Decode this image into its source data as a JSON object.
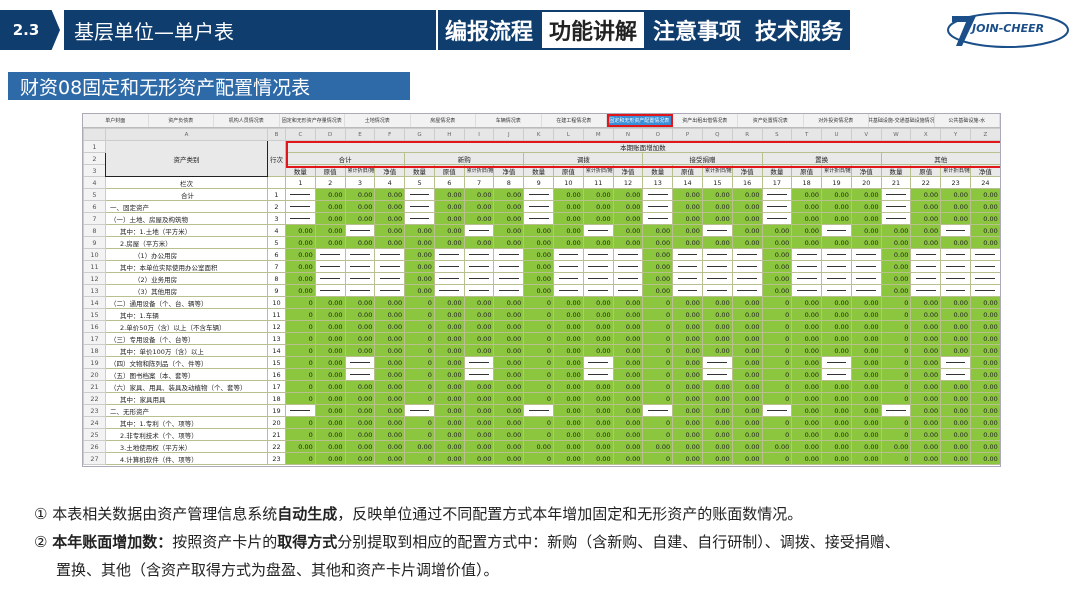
{
  "header": {
    "section_number": "2.3",
    "section_title": "基层单位—单户表",
    "tabs": [
      {
        "label": "编报流程",
        "active": false
      },
      {
        "label": "功能讲解",
        "active": true
      },
      {
        "label": "注意事项",
        "active": false
      },
      {
        "label": "技术服务",
        "active": false
      }
    ],
    "logo_text": "JOIN-CHEER",
    "colors": {
      "primary": "#0f3d6e",
      "accent": "#2e6aa8",
      "cell_green": "#8cc63f",
      "highlight": "#e0161b"
    }
  },
  "subtitle": "财资08固定和无形资产配置情况表",
  "sheet_tabs": [
    {
      "label": "单户封面",
      "active": false
    },
    {
      "label": "资产负债表",
      "active": false
    },
    {
      "label": "机构人员情况表",
      "active": false
    },
    {
      "label": "固定和无形资产存量情况表",
      "active": false
    },
    {
      "label": "土地情况表",
      "active": false
    },
    {
      "label": "房屋情况表",
      "active": false
    },
    {
      "label": "车辆情况表",
      "active": false
    },
    {
      "label": "在建工程情况表",
      "active": false
    },
    {
      "label": "固定和无形资产配置情况表",
      "active": true
    },
    {
      "label": "资产出租出借情况表",
      "active": false
    },
    {
      "label": "资产处置情况表",
      "active": false
    },
    {
      "label": "对外投资情况表",
      "active": false
    },
    {
      "label": "公共基础设施-交通基础设施情况表",
      "active": false
    },
    {
      "label": "公共基础设施-水",
      "active": false
    }
  ],
  "table": {
    "col_letters": [
      "",
      "A",
      "B",
      "C",
      "D",
      "E",
      "F",
      "G",
      "H",
      "I",
      "J",
      "K",
      "L",
      "M",
      "N",
      "O",
      "P",
      "Q",
      "R",
      "S",
      "T",
      "U",
      "V",
      "W",
      "X",
      "Y",
      "Z"
    ],
    "title": "本期账面增加数",
    "category_header": "资产类别",
    "row_header": "行次",
    "groups": [
      "合计",
      "新购",
      "调拨",
      "接受捐赠",
      "置换",
      "其他"
    ],
    "subcols": [
      "数量",
      "原值",
      "累计折旧/摊销",
      "净值"
    ],
    "col_label": "栏次",
    "col_numbers": [
      "1",
      "2",
      "3",
      "4",
      "5",
      "6",
      "7",
      "8",
      "9",
      "10",
      "11",
      "12",
      "13",
      "14",
      "15",
      "16",
      "17",
      "18",
      "19",
      "20",
      "21",
      "22",
      "23",
      "24"
    ],
    "rows": [
      {
        "cat": "合计",
        "order": "1",
        "cols": [
          "d",
          "0.00",
          "0.00",
          "0.00",
          "d",
          "0.00",
          "0.00",
          "0.00",
          "d",
          "0.00",
          "0.00",
          "0.00",
          "d",
          "0.00",
          "0.00",
          "0.00",
          "d",
          "0.00",
          "0.00",
          "0.00",
          "d",
          "0.00",
          "0.00",
          "0.00"
        ]
      },
      {
        "cat": "一、固定资产",
        "order": "2",
        "cols": [
          "d",
          "0.00",
          "0.00",
          "0.00",
          "d",
          "0.00",
          "0.00",
          "0.00",
          "d",
          "0.00",
          "0.00",
          "0.00",
          "d",
          "0.00",
          "0.00",
          "0.00",
          "d",
          "0.00",
          "0.00",
          "0.00",
          "d",
          "0.00",
          "0.00",
          "0.00"
        ]
      },
      {
        "cat": "（一）土地、房屋及构筑物",
        "order": "3",
        "cols": [
          "d",
          "0.00",
          "0.00",
          "0.00",
          "d",
          "0.00",
          "0.00",
          "0.00",
          "d",
          "0.00",
          "0.00",
          "0.00",
          "d",
          "0.00",
          "0.00",
          "0.00",
          "d",
          "0.00",
          "0.00",
          "0.00",
          "d",
          "0.00",
          "0.00",
          "0.00"
        ]
      },
      {
        "cat": "其中：1.土地（平方米）",
        "order": "4",
        "cols": [
          "0.00",
          "0.00",
          "d",
          "0.00",
          "0.00",
          "0.00",
          "d",
          "0.00",
          "0.00",
          "0.00",
          "d",
          "0.00",
          "0.00",
          "0.00",
          "d",
          "0.00",
          "0.00",
          "0.00",
          "d",
          "0.00",
          "0.00",
          "0.00",
          "d",
          "0.00"
        ]
      },
      {
        "cat": "2.房屋（平方米）",
        "order": "5",
        "cols": [
          "0.00",
          "0.00",
          "0.00",
          "0.00",
          "0.00",
          "0.00",
          "0.00",
          "0.00",
          "0.00",
          "0.00",
          "0.00",
          "0.00",
          "0.00",
          "0.00",
          "0.00",
          "0.00",
          "0.00",
          "0.00",
          "0.00",
          "0.00",
          "0.00",
          "0.00",
          "0.00",
          "0.00"
        ]
      },
      {
        "cat": "（1）办公用房",
        "order": "6",
        "cols": [
          "0.00",
          "d",
          "d",
          "d",
          "0.00",
          "d",
          "d",
          "d",
          "0.00",
          "d",
          "d",
          "d",
          "0.00",
          "d",
          "d",
          "d",
          "0.00",
          "d",
          "d",
          "d",
          "0.00",
          "d",
          "d",
          "d"
        ]
      },
      {
        "cat": "其中：本单位实际使用办公室面积",
        "order": "7",
        "cols": [
          "0.00",
          "d",
          "d",
          "d",
          "0.00",
          "d",
          "d",
          "d",
          "0.00",
          "d",
          "d",
          "d",
          "0.00",
          "d",
          "d",
          "d",
          "0.00",
          "d",
          "d",
          "d",
          "0.00",
          "d",
          "d",
          "d"
        ]
      },
      {
        "cat": "（2）业务用房",
        "order": "8",
        "cols": [
          "0.00",
          "d",
          "d",
          "d",
          "0.00",
          "d",
          "d",
          "d",
          "0.00",
          "d",
          "d",
          "d",
          "0.00",
          "d",
          "d",
          "d",
          "0.00",
          "d",
          "d",
          "d",
          "0.00",
          "d",
          "d",
          "d"
        ]
      },
      {
        "cat": "（3）其他用房",
        "order": "9",
        "cols": [
          "0.00",
          "d",
          "d",
          "d",
          "0.00",
          "d",
          "d",
          "d",
          "0.00",
          "d",
          "d",
          "d",
          "0.00",
          "d",
          "d",
          "d",
          "0.00",
          "d",
          "d",
          "d",
          "0.00",
          "d",
          "d",
          "d"
        ]
      },
      {
        "cat": "（二）通用设备（个、台、辆等）",
        "order": "10",
        "cols": [
          "0",
          "0.00",
          "0.00",
          "0.00",
          "0",
          "0.00",
          "0.00",
          "0.00",
          "0",
          "0.00",
          "0.00",
          "0.00",
          "0",
          "0.00",
          "0.00",
          "0.00",
          "0",
          "0.00",
          "0.00",
          "0.00",
          "0",
          "0.00",
          "0.00",
          "0.00"
        ]
      },
      {
        "cat": "其中：1.车辆",
        "order": "11",
        "cols": [
          "0",
          "0.00",
          "0.00",
          "0.00",
          "0",
          "0.00",
          "0.00",
          "0.00",
          "0",
          "0.00",
          "0.00",
          "0.00",
          "0",
          "0.00",
          "0.00",
          "0.00",
          "0",
          "0.00",
          "0.00",
          "0.00",
          "0",
          "0.00",
          "0.00",
          "0.00"
        ]
      },
      {
        "cat": "2.单价50万（含）以上（不含车辆）",
        "order": "12",
        "cols": [
          "0",
          "0.00",
          "0.00",
          "0.00",
          "0",
          "0.00",
          "0.00",
          "0.00",
          "0",
          "0.00",
          "0.00",
          "0.00",
          "0",
          "0.00",
          "0.00",
          "0.00",
          "0",
          "0.00",
          "0.00",
          "0.00",
          "0",
          "0.00",
          "0.00",
          "0.00"
        ]
      },
      {
        "cat": "（三）专用设备（个、台等）",
        "order": "13",
        "cols": [
          "0",
          "0.00",
          "0.00",
          "0.00",
          "0",
          "0.00",
          "0.00",
          "0.00",
          "0",
          "0.00",
          "0.00",
          "0.00",
          "0",
          "0.00",
          "0.00",
          "0.00",
          "0",
          "0.00",
          "0.00",
          "0.00",
          "0",
          "0.00",
          "0.00",
          "0.00"
        ]
      },
      {
        "cat": "其中：单价100万（含）以上",
        "order": "14",
        "cols": [
          "0",
          "0.00",
          "0.00",
          "0.00",
          "0",
          "0.00",
          "0.00",
          "0.00",
          "0",
          "0.00",
          "0.00",
          "0.00",
          "0",
          "0.00",
          "0.00",
          "0.00",
          "0",
          "0.00",
          "0.00",
          "0.00",
          "0",
          "0.00",
          "0.00",
          "0.00"
        ]
      },
      {
        "cat": "（四）文物和陈列品（个、件等）",
        "order": "15",
        "cols": [
          "0",
          "0.00",
          "d",
          "0.00",
          "0",
          "0.00",
          "d",
          "0.00",
          "0",
          "0.00",
          "d",
          "0.00",
          "0",
          "0.00",
          "d",
          "0.00",
          "0",
          "0.00",
          "d",
          "0.00",
          "0",
          "0.00",
          "d",
          "0.00"
        ]
      },
      {
        "cat": "（五）图书档案（本、套等）",
        "order": "16",
        "cols": [
          "0",
          "0.00",
          "d",
          "0.00",
          "0",
          "0.00",
          "d",
          "0.00",
          "0",
          "0.00",
          "d",
          "0.00",
          "0",
          "0.00",
          "d",
          "0.00",
          "0",
          "0.00",
          "d",
          "0.00",
          "0",
          "0.00",
          "d",
          "0.00"
        ]
      },
      {
        "cat": "（六）家具、用具、装具及动植物（个、套等）",
        "order": "17",
        "cols": [
          "0",
          "0.00",
          "0.00",
          "0.00",
          "0",
          "0.00",
          "0.00",
          "0.00",
          "0",
          "0.00",
          "0.00",
          "0.00",
          "0",
          "0.00",
          "0.00",
          "0.00",
          "0",
          "0.00",
          "0.00",
          "0.00",
          "0",
          "0.00",
          "0.00",
          "0.00"
        ]
      },
      {
        "cat": "其中：家具用具",
        "order": "18",
        "cols": [
          "0",
          "0.00",
          "0.00",
          "0.00",
          "0",
          "0.00",
          "0.00",
          "0.00",
          "0",
          "0.00",
          "0.00",
          "0.00",
          "0",
          "0.00",
          "0.00",
          "0.00",
          "0",
          "0.00",
          "0.00",
          "0.00",
          "0",
          "0.00",
          "0.00",
          "0.00"
        ]
      },
      {
        "cat": "二、无形资产",
        "order": "19",
        "cols": [
          "d",
          "0.00",
          "0.00",
          "0.00",
          "d",
          "0.00",
          "0.00",
          "0.00",
          "d",
          "0.00",
          "0.00",
          "0.00",
          "d",
          "0.00",
          "0.00",
          "0.00",
          "d",
          "0.00",
          "0.00",
          "0.00",
          "d",
          "0.00",
          "0.00",
          "0.00"
        ]
      },
      {
        "cat": "其中：1.专利（个、项等）",
        "order": "20",
        "cols": [
          "0",
          "0.00",
          "0.00",
          "0.00",
          "0",
          "0.00",
          "0.00",
          "0.00",
          "0",
          "0.00",
          "0.00",
          "0.00",
          "0",
          "0.00",
          "0.00",
          "0.00",
          "0",
          "0.00",
          "0.00",
          "0.00",
          "0",
          "0.00",
          "0.00",
          "0.00"
        ]
      },
      {
        "cat": "2.非专利技术（个、项等）",
        "order": "21",
        "cols": [
          "0",
          "0.00",
          "0.00",
          "0.00",
          "0",
          "0.00",
          "0.00",
          "0.00",
          "0",
          "0.00",
          "0.00",
          "0.00",
          "0",
          "0.00",
          "0.00",
          "0.00",
          "0",
          "0.00",
          "0.00",
          "0.00",
          "0",
          "0.00",
          "0.00",
          "0.00"
        ]
      },
      {
        "cat": "3.土地使用权（平方米）",
        "order": "22",
        "cols": [
          "0.00",
          "0.00",
          "0.00",
          "0.00",
          "0.00",
          "0.00",
          "0.00",
          "0.00",
          "0.00",
          "0.00",
          "0.00",
          "0.00",
          "0.00",
          "0.00",
          "0.00",
          "0.00",
          "0.00",
          "0.00",
          "0.00",
          "0.00",
          "0.00",
          "0.00",
          "0.00",
          "0.00"
        ]
      },
      {
        "cat": "4.计算机软件（件、项等）",
        "order": "23",
        "cols": [
          "0",
          "0.00",
          "0.00",
          "0.00",
          "0",
          "0.00",
          "0.00",
          "0.00",
          "0",
          "0.00",
          "0.00",
          "0.00",
          "0",
          "0.00",
          "0.00",
          "0.00",
          "0",
          "0.00",
          "0.00",
          "0.00",
          "0",
          "0.00",
          "0.00",
          "0.00"
        ]
      }
    ]
  },
  "notes": {
    "n1_prefix": "① 本表相关数据由资产管理信息系统",
    "n1_bold": "自动生成",
    "n1_suffix": "，反映单位通过不同配置方式本年增加固定和无形资产的账面数情况。",
    "n2_prefix": "② ",
    "n2_bold1": "本年账面增加数：",
    "n2_mid": "按照资产卡片的",
    "n2_bold2": "取得方式",
    "n2_suffix": "分别提取到相应的配置方式中：新购（含新购、自建、自行研制）、调拨、接受捐赠、",
    "n2_line2": "置换、其他（含资产取得方式为盘盈、其他和资产卡片调增价值）。"
  }
}
